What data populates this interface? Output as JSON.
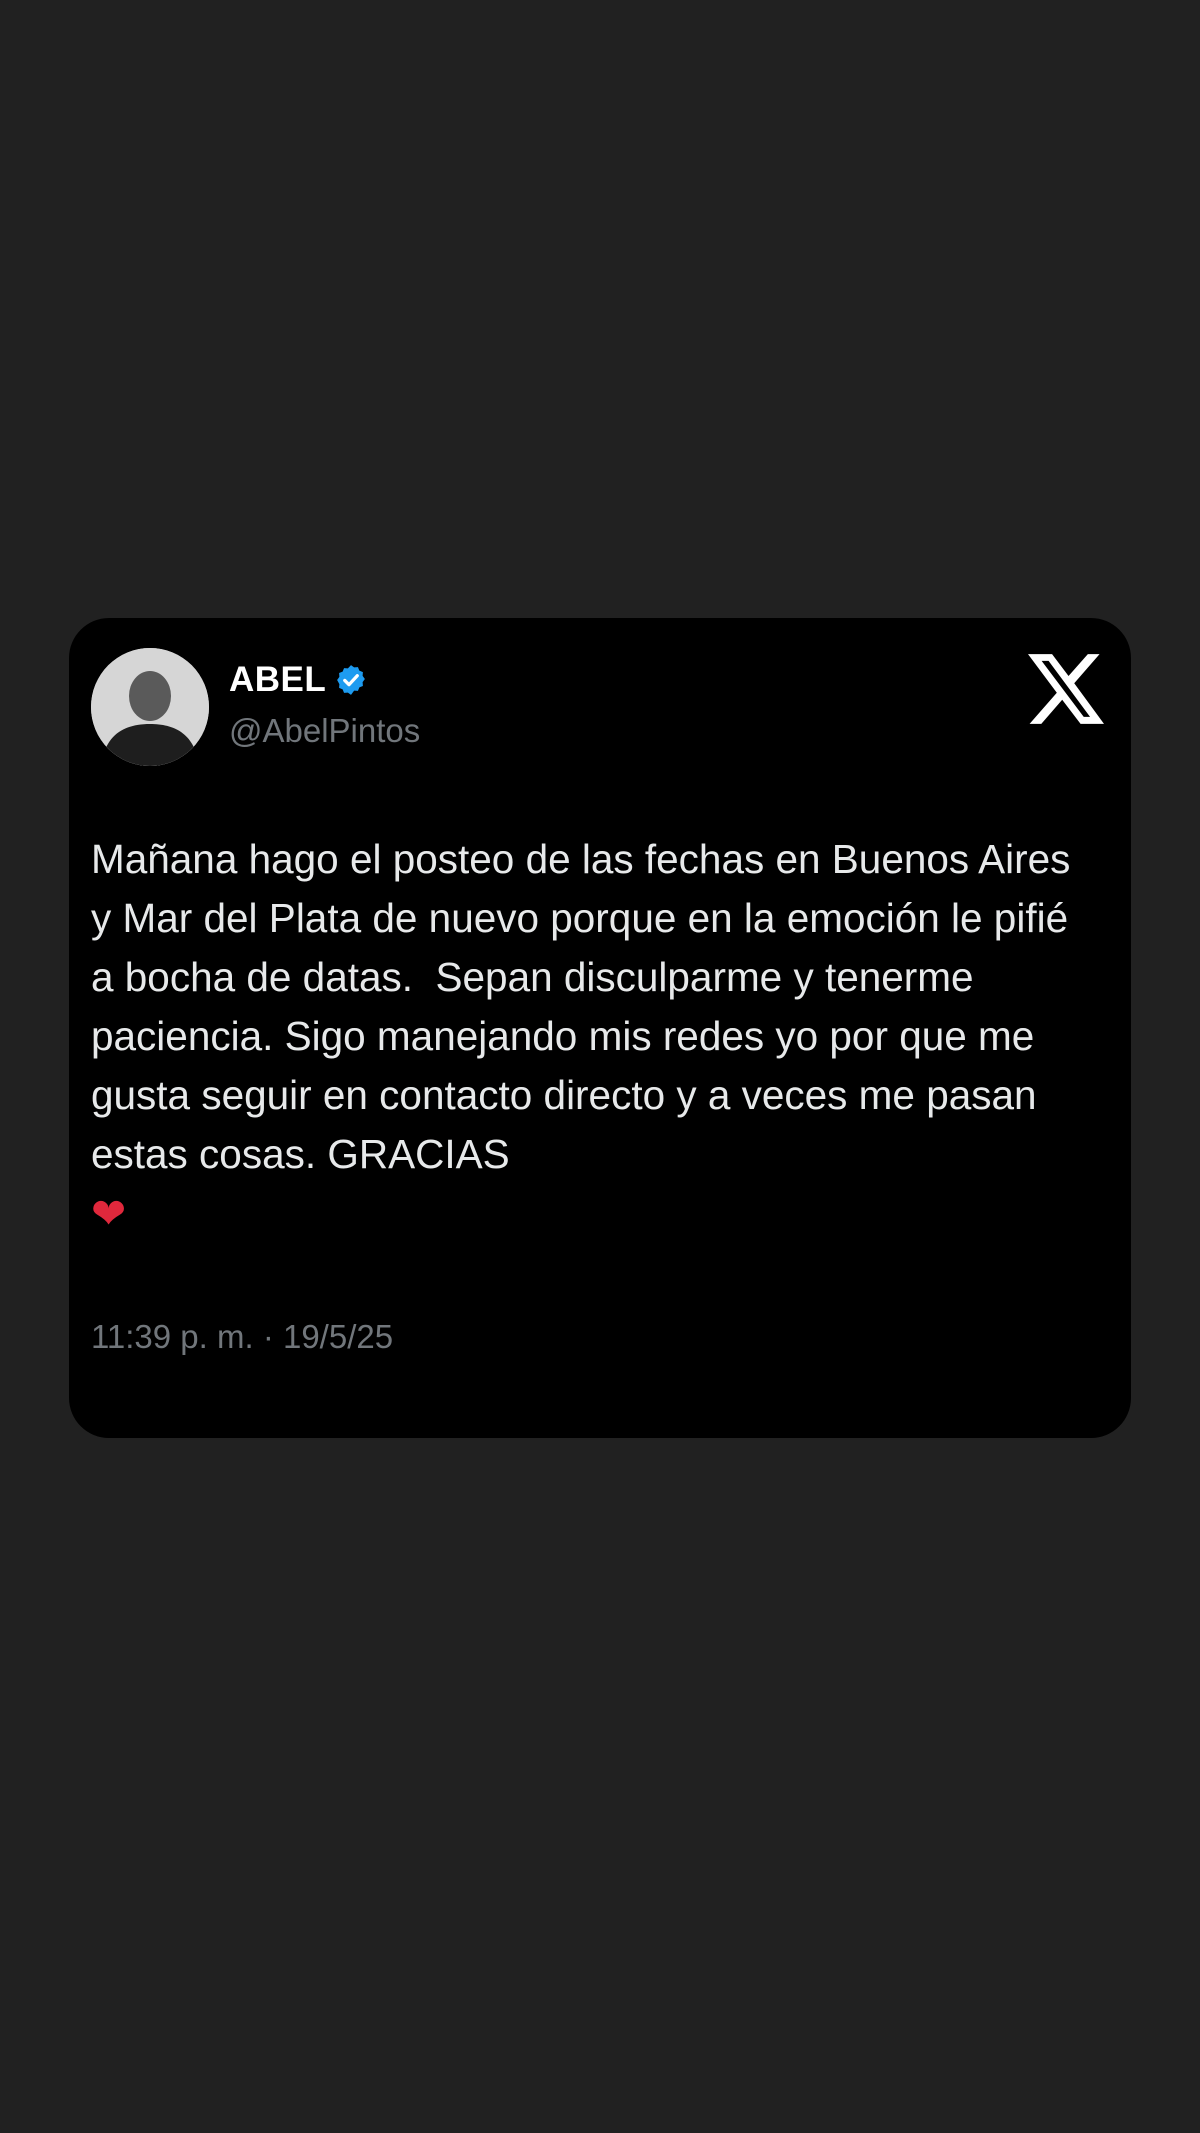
{
  "tweet": {
    "display_name": "ABEL",
    "handle": "@AbelPintos",
    "text": "Mañana hago el posteo de las fechas en Buenos Aires y Mar del Plata de nuevo porque en la emoción le pifié a bocha de datas.  Sepan disculparme y tenerme paciencia. Sigo manejando mis redes yo por que me gusta seguir en contacto directo y a veces me pasan estas cosas. GRACIAS",
    "emoji": "❤",
    "timestamp": "11:39 p. m. · 19/5/25"
  },
  "icons": {
    "verified": "verified-badge-icon",
    "brand": "x-logo-icon",
    "emoji": "red-heart-icon"
  },
  "colors": {
    "background": "#212121",
    "card": "#000000",
    "text": "#e7e9ea",
    "secondary_text": "#71767b",
    "verified_blue": "#1d9bf0",
    "heart_red": "#e0283c"
  }
}
